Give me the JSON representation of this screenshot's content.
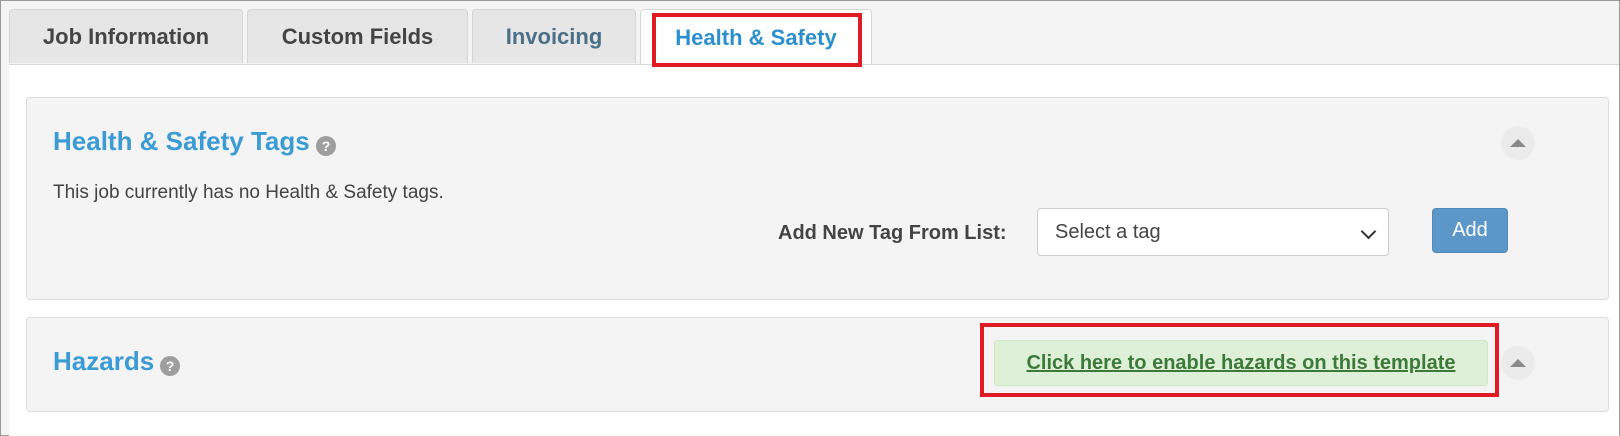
{
  "tabs": [
    {
      "label": "Job Information"
    },
    {
      "label": "Custom Fields"
    },
    {
      "label": "Invoicing"
    },
    {
      "label": "Health & Safety"
    }
  ],
  "active_tab": "Health & Safety",
  "tags_section": {
    "title": "Health & Safety Tags",
    "help_glyph": "?",
    "empty_message": "This job currently has no Health & Safety tags.",
    "add_label": "Add New Tag From List:",
    "select_value": "Select a tag",
    "add_button": "Add"
  },
  "hazards_section": {
    "title": "Hazards",
    "help_glyph": "?",
    "enable_link": "Click here to enable hazards on this template"
  },
  "colors": {
    "accent": "#3a9bd5",
    "active_tab_text": "#2c8fd0",
    "highlight_box": "#e01b24",
    "add_button": "#5b97c9",
    "enable_link_bg": "#dff0d8",
    "enable_link_text": "#3c7a3a"
  },
  "icons": {
    "help": "question-circle-icon",
    "collapse": "caret-up-icon",
    "select": "chevron-down-icon"
  }
}
